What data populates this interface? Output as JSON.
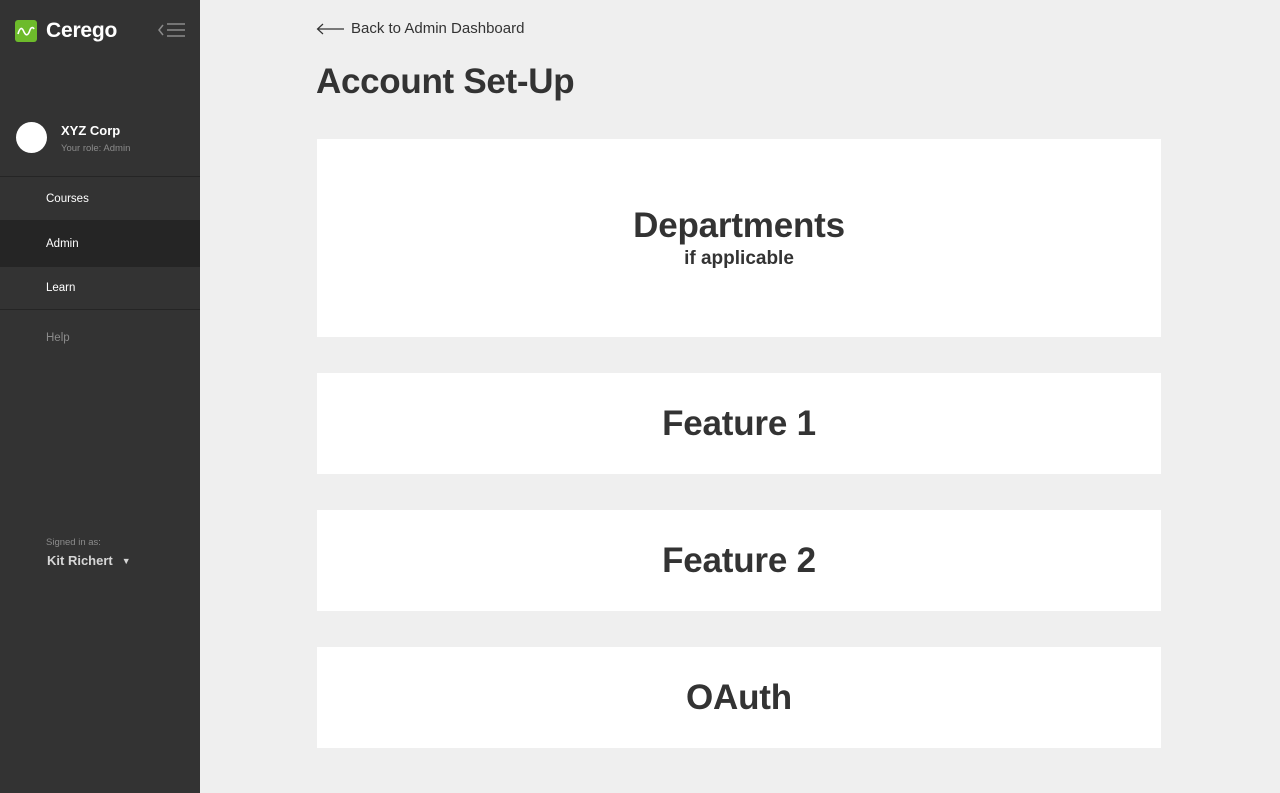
{
  "brand": {
    "name": "Cerego",
    "accent_color": "#6dbb2b"
  },
  "sidebar": {
    "org_name": "XYZ Corp",
    "org_role": "Your role: Admin",
    "nav_items": [
      {
        "label": "Courses",
        "active": false
      },
      {
        "label": "Admin",
        "active": true
      },
      {
        "label": "Learn",
        "active": false
      }
    ],
    "help_label": "Help",
    "signed_in_label": "Signed in as:",
    "user_name": "Kit Richert"
  },
  "main": {
    "back_label": "Back to Admin Dashboard",
    "title": "Account Set-Up",
    "cards": [
      {
        "title": "Departments",
        "subtitle": "if applicable"
      },
      {
        "title": "Feature 1"
      },
      {
        "title": "Feature 2"
      },
      {
        "title": "OAuth"
      }
    ]
  }
}
